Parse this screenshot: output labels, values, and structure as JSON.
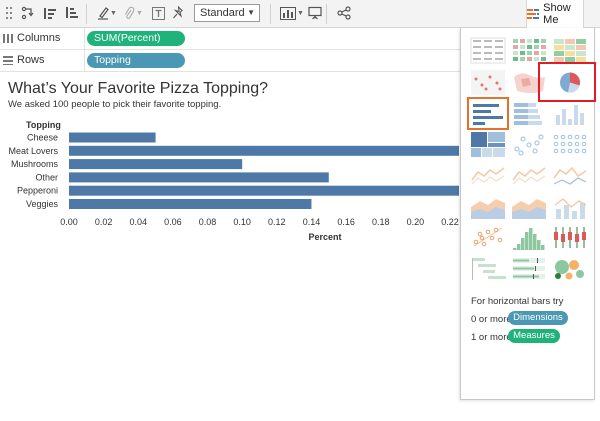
{
  "toolbar": {
    "format_dropdown": "Standard",
    "show_me_label": "Show Me"
  },
  "shelves": {
    "columns_label": "Columns",
    "columns_pill": "SUM(Percent)",
    "rows_label": "Rows",
    "rows_pill": "Topping"
  },
  "colors": {
    "bar": "#4e79a7",
    "measure_pill": "#1fb27a",
    "dimension_pill": "#4a98b3",
    "selection_outline": "#e8702a",
    "highlight_box": "#e01c24"
  },
  "chart_data": {
    "type": "bar",
    "orientation": "horizontal",
    "title": "What’s Your Favorite Pizza Topping?",
    "subtitle": "We asked 100 people to pick their favorite topping.",
    "row_header": "Topping",
    "xlabel": "Percent",
    "categories": [
      "Cheese",
      "Meat Lovers",
      "Mushrooms",
      "Other",
      "Pepperoni",
      "Veggies"
    ],
    "values": [
      0.05,
      0.24,
      0.1,
      0.15,
      0.24,
      0.14
    ],
    "xticks": [
      "0.00",
      "0.02",
      "0.04",
      "0.06",
      "0.08",
      "0.10",
      "0.12",
      "0.14",
      "0.16",
      "0.18",
      "0.20",
      "0.22"
    ],
    "xlim": [
      0,
      0.225
    ]
  },
  "show_me": {
    "hint_title": "For horizontal bars try",
    "dimensions_count": "0 or more",
    "dimensions_label": "Dimensions",
    "measures_count": "1 or more",
    "measures_label": "Measures",
    "chart_types": [
      "text-table",
      "heat-map",
      "highlight-table",
      "symbol-map",
      "filled-map",
      "pie-chart",
      "horizontal-bars",
      "stacked-bars",
      "side-by-side-bars",
      "treemap",
      "circle-views",
      "side-by-side-circles",
      "lines-continuous",
      "lines-discrete",
      "dual-lines",
      "area-continuous",
      "area-discrete",
      "dual-combination",
      "scatter-plot",
      "histogram",
      "box-and-whisker",
      "gantt-chart",
      "bullet-graph",
      "packed-bubbles"
    ],
    "selected_chart": "horizontal-bars",
    "highlighted_chart": "pie-chart"
  }
}
